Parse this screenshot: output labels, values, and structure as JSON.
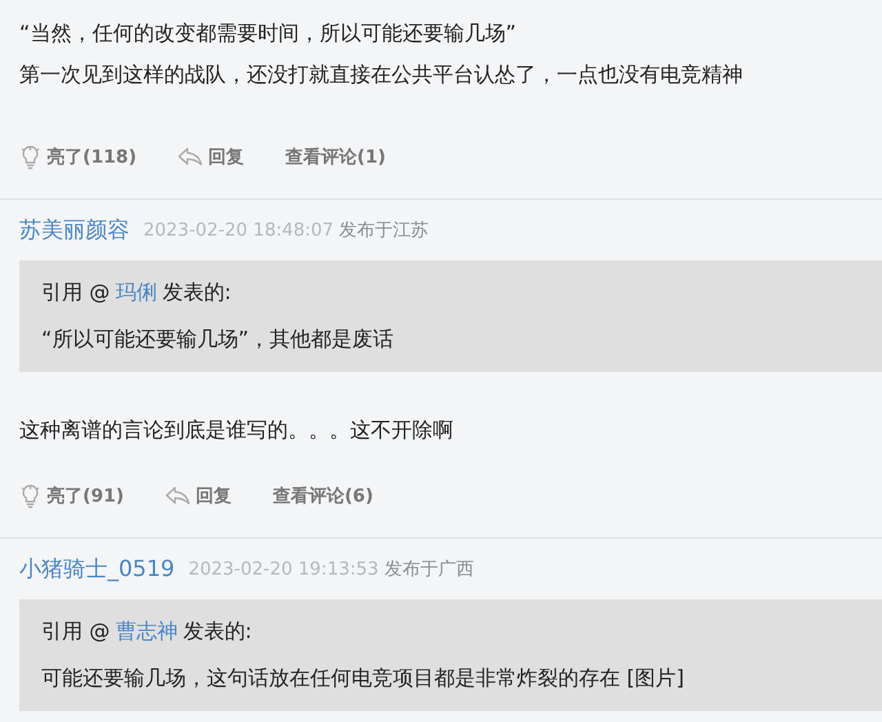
{
  "posts": [
    {
      "paragraphs": [
        "“当然，任何的改变都需要时间，所以可能还要输几场”",
        "第一次见到这样的战队，还没打就直接在公共平台认怂了，一点也没有电竞精神"
      ],
      "actions": {
        "likes": "亮了(118)",
        "reply": "回复",
        "comments": "查看评论(1)"
      }
    },
    {
      "author": "苏美丽颜容",
      "time": "2023-02-20 18:48:07",
      "location": "发布于江苏",
      "quote": {
        "label": "引用 @",
        "user": "玛俐",
        "suffix": "发表的:",
        "text": "“所以可能还要输几场”，其他都是废话"
      },
      "paragraphs": [
        "这种离谱的言论到底是谁写的。。。这不开除啊"
      ],
      "actions": {
        "likes": "亮了(91)",
        "reply": "回复",
        "comments": "查看评论(6)"
      }
    },
    {
      "author": "小猪骑士_0519",
      "time": "2023-02-20 19:13:53",
      "location": "发布于广西",
      "quote": {
        "label": "引用 @",
        "user": "曹志神",
        "suffix": "发表的:",
        "text": "可能还要输几场，这句话放在任何电竞项目都是非常炸裂的存在 [图片]"
      }
    }
  ]
}
